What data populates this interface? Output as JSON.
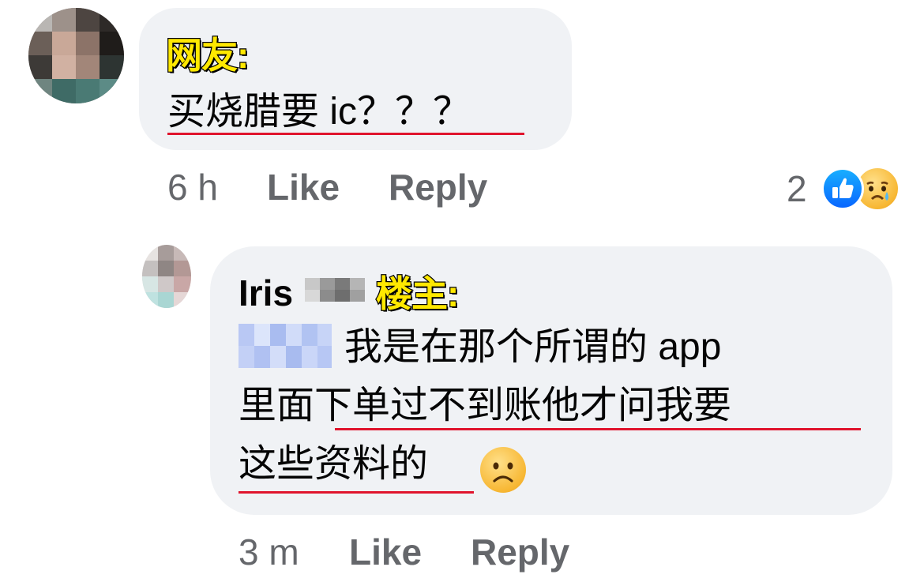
{
  "comment1": {
    "author_tag": "网友:",
    "text": "买烧腊要 ic？？？",
    "time": "6 h",
    "like_label": "Like",
    "reply_label": "Reply",
    "reaction_count": "2",
    "reactions": [
      "like-icon",
      "sad-cry-icon"
    ]
  },
  "comment2": {
    "author_name": "Iris",
    "author_tag": "楼主:",
    "line1": "我是在那个所谓的 app",
    "line2": "里面下单过不到账他才问我要",
    "line3": "这些资料的",
    "time": "3 m",
    "like_label": "Like",
    "reply_label": "Reply",
    "emoji": "frowning-face-icon"
  },
  "colors": {
    "bubble": "#f0f2f5",
    "meta_text": "#65676b",
    "underline": "#e0142d",
    "tag_yellow": "#ffe800",
    "like_blue": "#0866ff"
  }
}
